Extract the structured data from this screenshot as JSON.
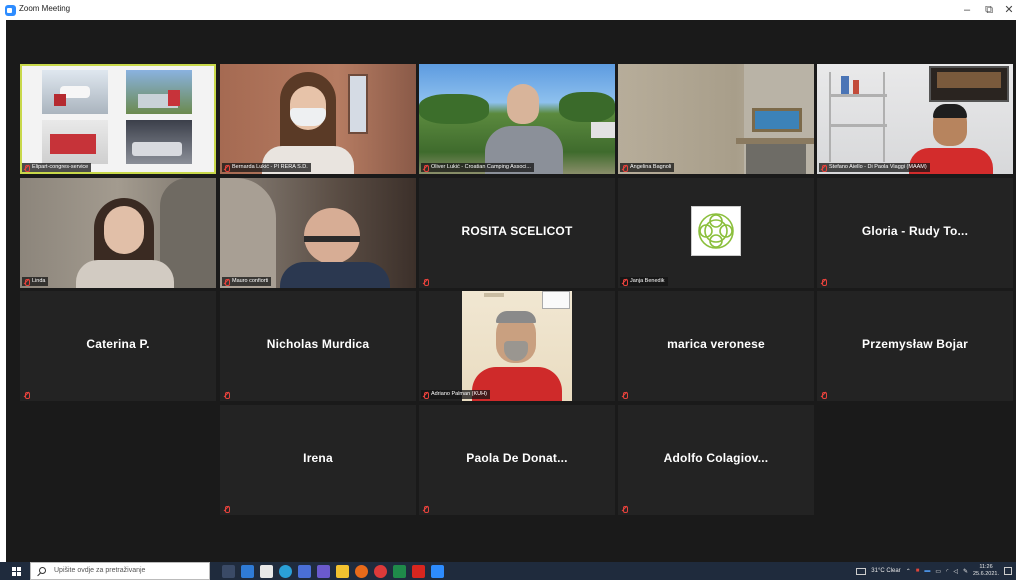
{
  "window": {
    "title": "Zoom Meeting",
    "controls": [
      "–",
      "⧉",
      "✕"
    ]
  },
  "participants": [
    {
      "name": "Elipart-congres-service",
      "type": "video",
      "scene": "collage"
    },
    {
      "name": "Bernarda Lukić - PI RERA S.D.",
      "type": "video",
      "scene": "woman-mask"
    },
    {
      "name": "Oliver Lukić - Croatian Camping Associ...",
      "type": "video",
      "scene": "man-outdoor"
    },
    {
      "name": "Angelina Bagnoli",
      "type": "video",
      "scene": "room-fireplace"
    },
    {
      "name": "Stefano Aiello - Di Paola Viaggi (MAAM)",
      "type": "video",
      "scene": "man-shelves"
    },
    {
      "name": "Linda",
      "type": "video",
      "scene": "woman-stone"
    },
    {
      "name": "Mauro confiorti",
      "type": "video",
      "scene": "man-glasses"
    },
    {
      "name": "ROSITA SCELICOT",
      "type": "name"
    },
    {
      "name": "Janja Benedik",
      "type": "logo"
    },
    {
      "name": "Gloria - Rudy To...",
      "type": "name"
    },
    {
      "name": "Caterina P.",
      "type": "name"
    },
    {
      "name": "Nicholas Murdica",
      "type": "name"
    },
    {
      "name": "Adriano Palman (KUH)",
      "type": "video",
      "scene": "man-red"
    },
    {
      "name": "marica veronese",
      "type": "name"
    },
    {
      "name": "Przemysław Bojar",
      "type": "name"
    },
    {
      "name": "Irena",
      "type": "name"
    },
    {
      "name": "Paola De Donat...",
      "type": "name"
    },
    {
      "name": "Adolfo Colagiov...",
      "type": "name"
    }
  ],
  "taskbar": {
    "search_placeholder": "Upišite ovdje za pretraživanje",
    "weather": "31°C Clear",
    "time": "11:26",
    "date": "25.6.2021."
  },
  "colors": {
    "active_speaker": "#c8d84a",
    "muted_mic": "#e6423c",
    "tile_bg": "#232323",
    "stage_bg": "#1a1a1a"
  }
}
